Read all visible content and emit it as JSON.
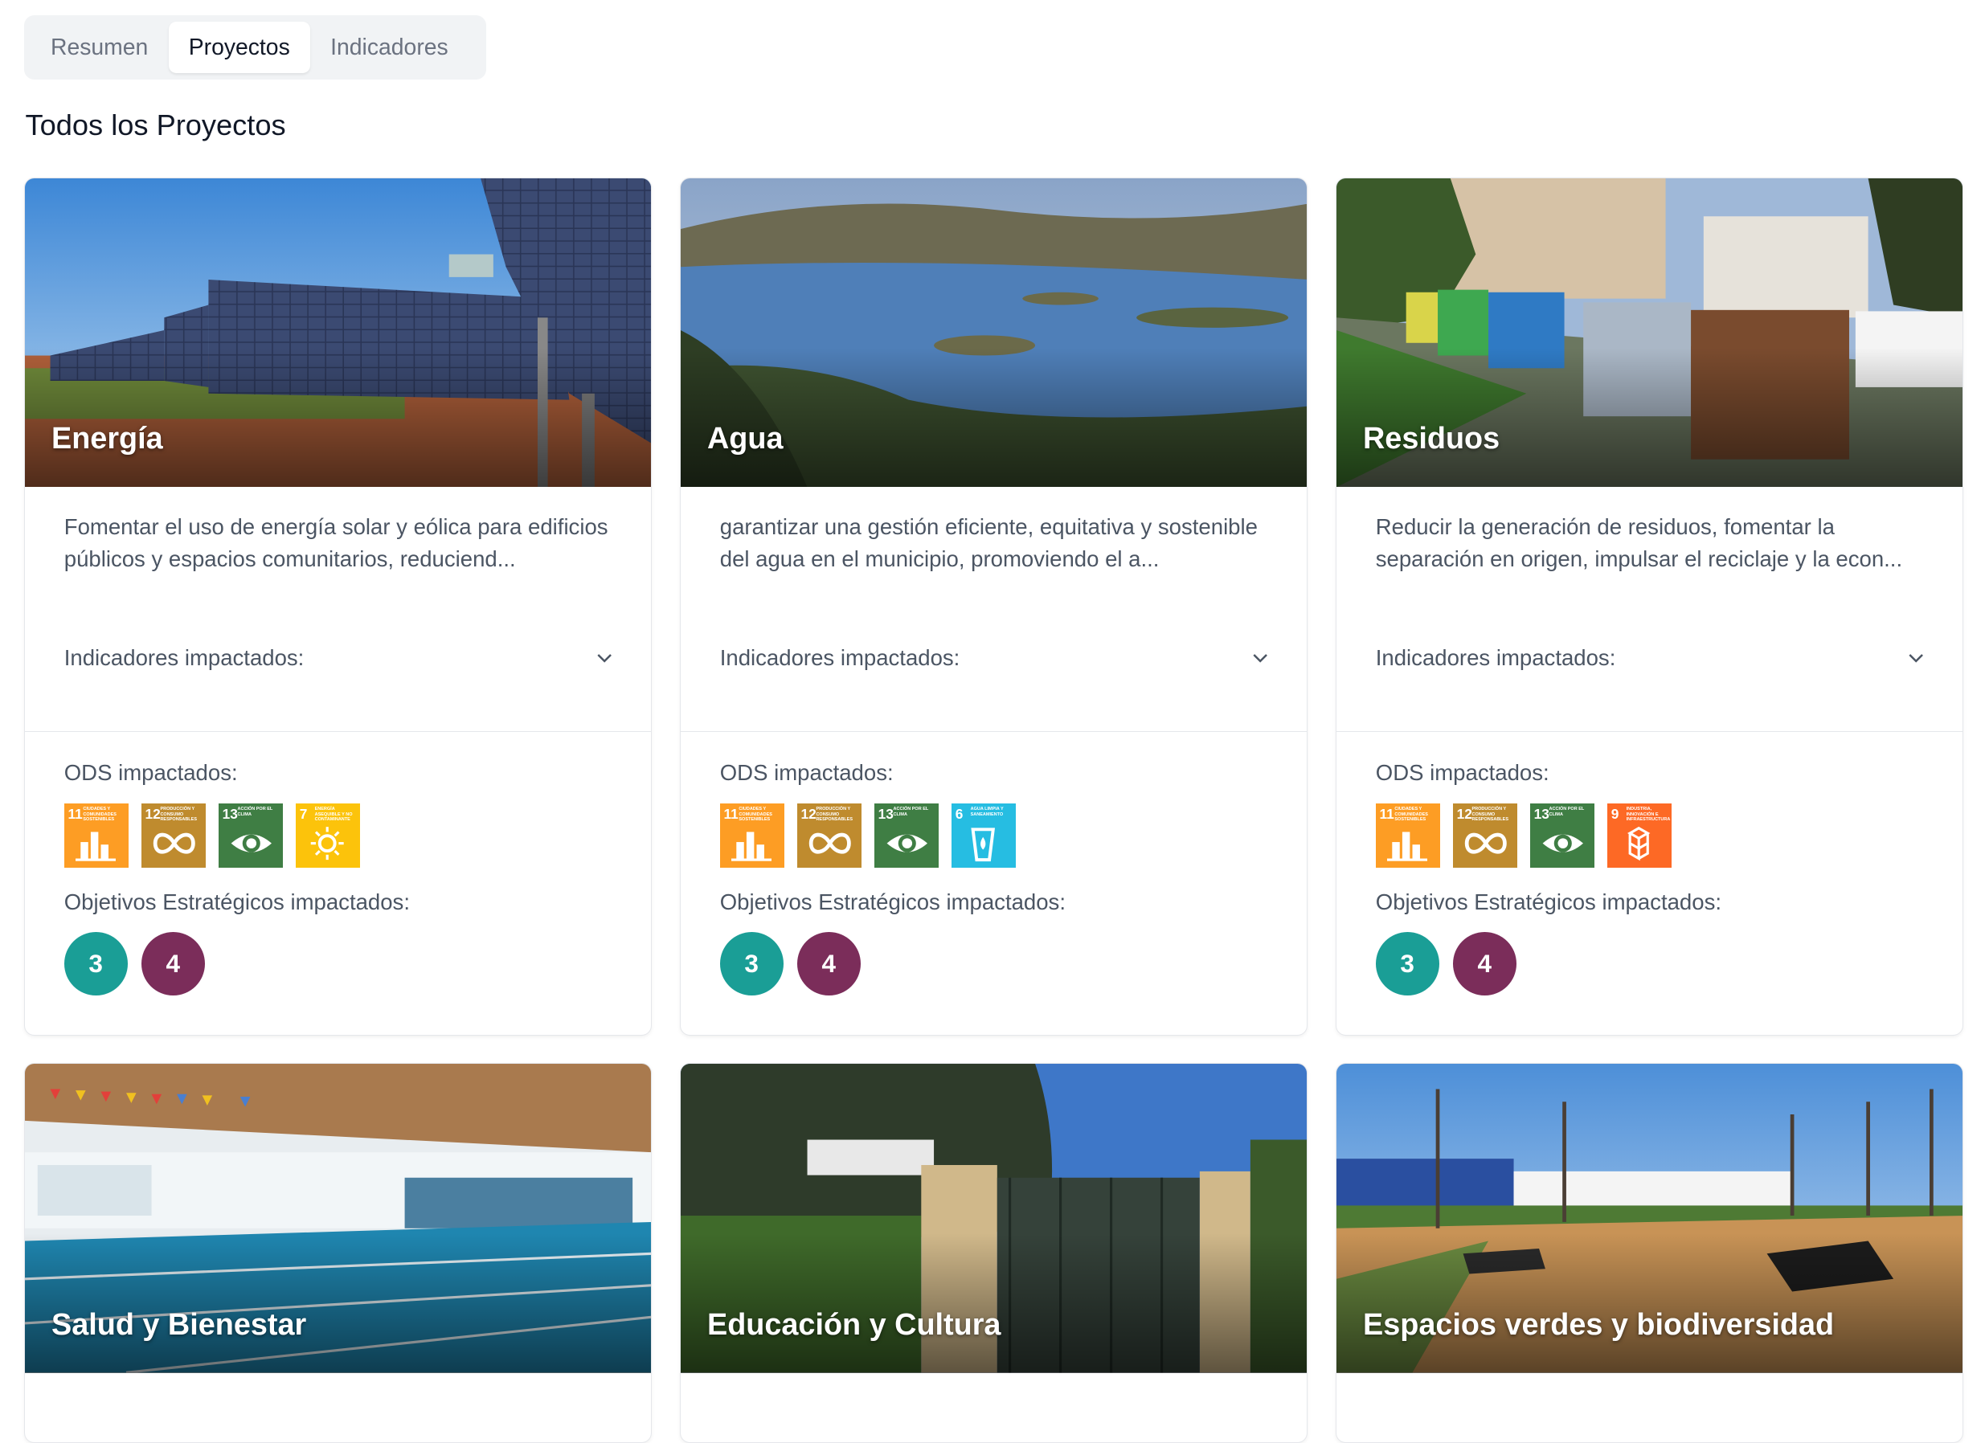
{
  "tabs": [
    {
      "label": "Resumen",
      "active": false
    },
    {
      "label": "Proyectos",
      "active": true
    },
    {
      "label": "Indicadores",
      "active": false
    }
  ],
  "page_title": "Todos los Proyectos",
  "labels": {
    "indicadores": "Indicadores impactados:",
    "ods": "ODS impactados:",
    "objetivos": "Objetivos Estratégicos impactados:"
  },
  "colors": {
    "sdg_6": "#26bde2",
    "sdg_7": "#fcc30b",
    "sdg_9": "#fd6925",
    "sdg_11": "#fd9d24",
    "sdg_12": "#bf8b2e",
    "sdg_13": "#3f7e44",
    "objective_3": "#1a9e96",
    "objective_4": "#7b2d5a"
  },
  "projects": [
    {
      "title": "Energía",
      "description": "Fomentar el uso de energía solar y eólica para edificios públicos y espacios comunitarios, reduciend...",
      "ods": [
        {
          "number": "11",
          "text": "CIUDADES Y COMUNIDADES SOSTENIBLES",
          "icon": "city-icon"
        },
        {
          "number": "12",
          "text": "PRODUCCIÓN Y CONSUMO RESPONSABLES",
          "icon": "infinity-icon"
        },
        {
          "number": "13",
          "text": "ACCIÓN POR EL CLIMA",
          "icon": "eye-globe-icon"
        },
        {
          "number": "7",
          "text": "ENERGÍA ASEQUIBLE Y NO CONTAMINANTE",
          "icon": "sun-icon"
        }
      ],
      "objectives": [
        "3",
        "4"
      ]
    },
    {
      "title": "Agua",
      "description": "garantizar una gestión eficiente, equitativa y sostenible del agua en el municipio, promoviendo el a...",
      "ods": [
        {
          "number": "11",
          "text": "CIUDADES Y COMUNIDADES SOSTENIBLES",
          "icon": "city-icon"
        },
        {
          "number": "12",
          "text": "PRODUCCIÓN Y CONSUMO RESPONSABLES",
          "icon": "infinity-icon"
        },
        {
          "number": "13",
          "text": "ACCIÓN POR EL CLIMA",
          "icon": "eye-globe-icon"
        },
        {
          "number": "6",
          "text": "AGUA LIMPIA Y SANEAMIENTO",
          "icon": "water-glass-icon"
        }
      ],
      "objectives": [
        "3",
        "4"
      ]
    },
    {
      "title": "Residuos",
      "description": "Reducir la generación de residuos, fomentar la separación en origen, impulsar el reciclaje y la econ...",
      "ods": [
        {
          "number": "11",
          "text": "CIUDADES Y COMUNIDADES SOSTENIBLES",
          "icon": "city-icon"
        },
        {
          "number": "12",
          "text": "PRODUCCIÓN Y CONSUMO RESPONSABLES",
          "icon": "infinity-icon"
        },
        {
          "number": "13",
          "text": "ACCIÓN POR EL CLIMA",
          "icon": "eye-globe-icon"
        },
        {
          "number": "9",
          "text": "INDUSTRIA, INNOVACIÓN E INFRAESTRUCTURA",
          "icon": "cubes-icon"
        }
      ],
      "objectives": [
        "3",
        "4"
      ]
    },
    {
      "title": "Salud y Bienestar"
    },
    {
      "title": "Educación y Cultura"
    },
    {
      "title": "Espacios verdes y biodiversidad"
    }
  ]
}
